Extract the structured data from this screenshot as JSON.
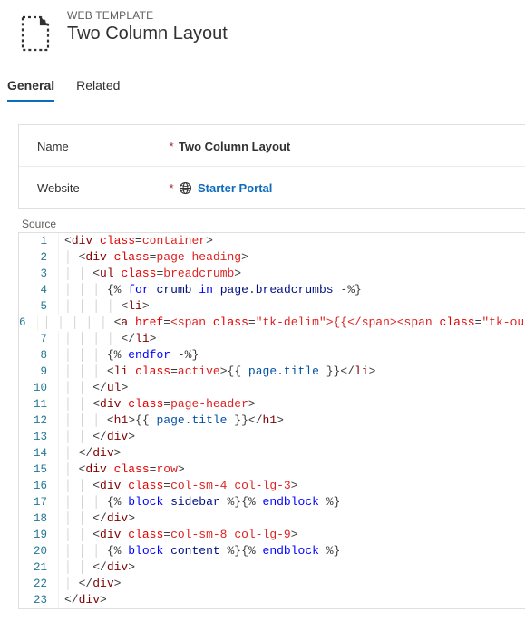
{
  "header": {
    "entity_type": "WEB TEMPLATE",
    "title": "Two Column Layout"
  },
  "tabs": {
    "items": [
      {
        "label": "General",
        "active": true
      },
      {
        "label": "Related",
        "active": false
      }
    ]
  },
  "form": {
    "name_field_label": "Name",
    "name_value": "Two Column Layout",
    "website_field_label": "Website",
    "website_value": "Starter Portal",
    "required_marker": "*"
  },
  "source": {
    "label": "Source",
    "lines": [
      "<div class=container>",
      "  <div class=page-heading>",
      "    <ul class=breadcrumb>",
      "      {% for crumb in page.breadcrumbs -%}",
      "        <li>",
      "          <a href={{ crumb.url }}>{{ crumb.title }}</a>",
      "        </li>",
      "      {% endfor -%}",
      "      <li class=active>{{ page.title }}</li>",
      "    </ul>",
      "    <div class=page-header>",
      "      <h1>{{ page.title }}</h1>",
      "    </div>",
      "  </div>",
      "  <div class=row>",
      "    <div class=col-sm-4 col-lg-3>",
      "      {% block sidebar %}{% endblock %}",
      "    </div>",
      "    <div class=col-sm-8 col-lg-9>",
      "      {% block content %}{% endblock %}",
      "    </div>",
      "  </div>",
      "</div>"
    ]
  }
}
